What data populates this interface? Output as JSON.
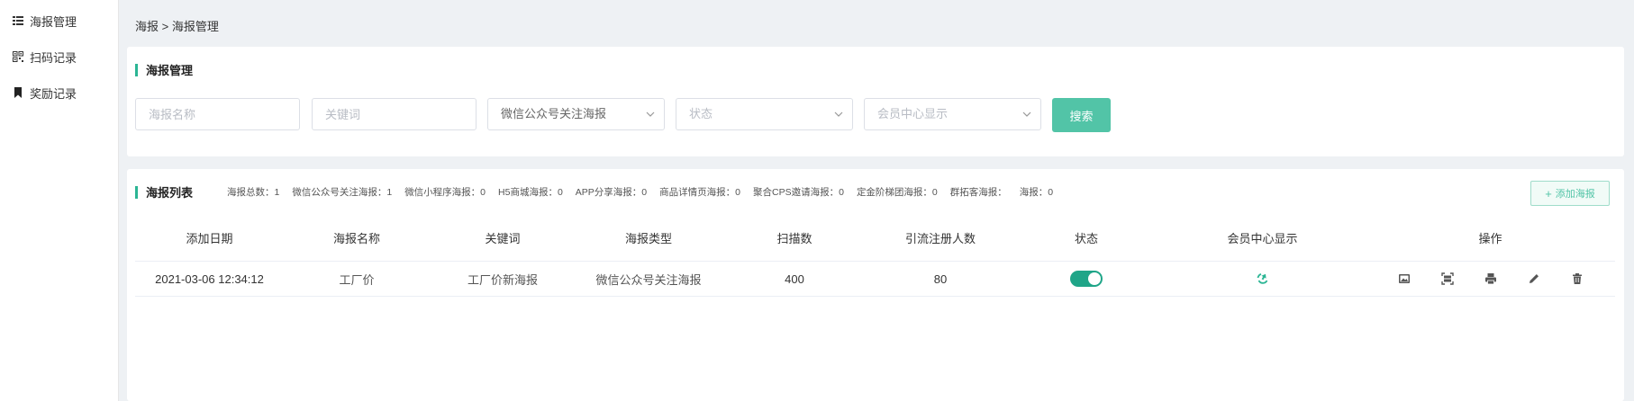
{
  "sidebar": {
    "items": [
      {
        "label": "海报管理",
        "icon": "list-icon"
      },
      {
        "label": "扫码记录",
        "icon": "qrcode-icon"
      },
      {
        "label": "奖励记录",
        "icon": "bookmark-icon"
      }
    ]
  },
  "breadcrumb": "海报 > 海报管理",
  "search_panel": {
    "title": "海报管理",
    "name_placeholder": "海报名称",
    "keyword_placeholder": "关键词",
    "type_value": "微信公众号关注海报",
    "status_placeholder": "状态",
    "member_placeholder": "会员中心显示",
    "search_label": "搜索"
  },
  "list_panel": {
    "title": "海报列表",
    "stats": [
      "海报总数：1",
      "微信公众号关注海报：1",
      "微信小程序海报：0",
      "H5商城海报：0",
      "APP分享海报：0",
      "商品详情页海报：0",
      "聚合CPS邀请海报：0",
      "定金阶梯团海报：0",
      "群拓客海报：",
      "海报：0"
    ],
    "add_label": "添加海报",
    "columns": [
      "添加日期",
      "海报名称",
      "关键词",
      "海报类型",
      "扫描数",
      "引流注册人数",
      "状态",
      "会员中心显示",
      "操作"
    ],
    "rows": [
      {
        "date": "2021-03-06 12:34:12",
        "name": "工厂价",
        "keyword": "工厂价新海报",
        "type": "微信公众号关注海报",
        "scans": "400",
        "registrations": "80",
        "status_on": true
      }
    ]
  },
  "colors": {
    "accent": "#52c4a7",
    "switch_on": "#1fa588",
    "title_bar": "#2bb594"
  }
}
